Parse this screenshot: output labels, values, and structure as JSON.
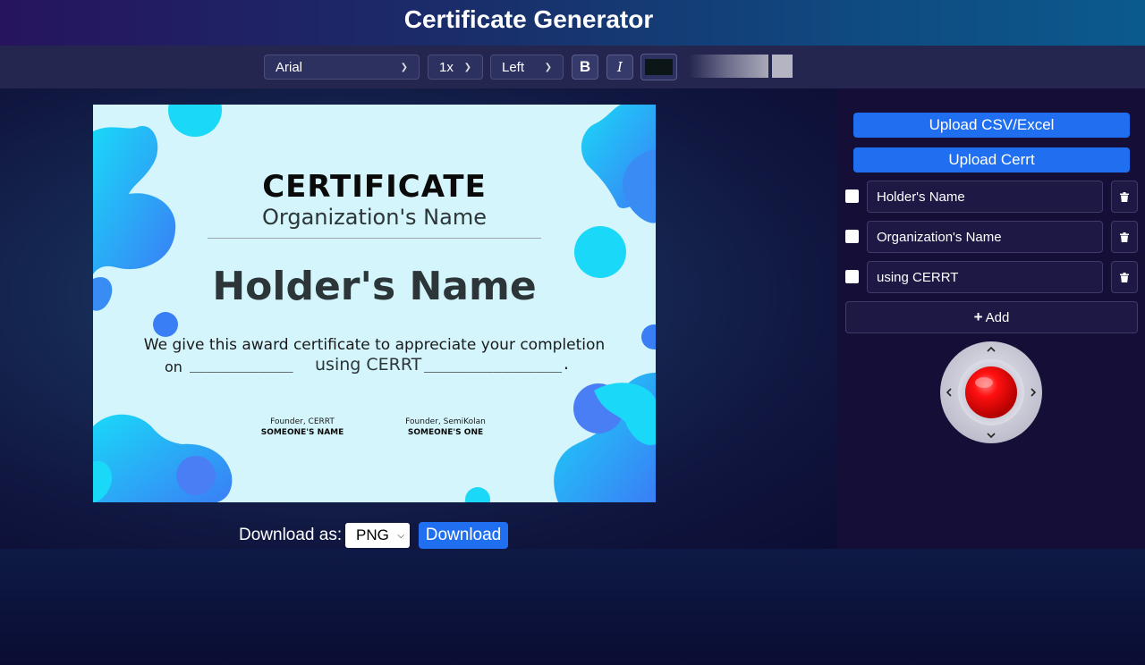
{
  "header": {
    "title": "Certificate Generator"
  },
  "toolbar": {
    "font": "Arial",
    "size": "1x",
    "align": "Left",
    "bold_label": "B",
    "italic_label": "I",
    "text_color": "#0c1617"
  },
  "certificate": {
    "title": "CERTIFICATE",
    "organization": "Organization's Name",
    "holder": "Holder's Name",
    "text_line1": "We give this award certificate to appreciate your completion",
    "text_on": "on",
    "blank_left": "____________",
    "using": "using CERRT",
    "blank_right": "________________.",
    "signatures": [
      {
        "role": "Founder, CERRT",
        "name": "SOMEONE'S NAME"
      },
      {
        "role": "Founder, SemiKolan",
        "name": "SOMEONE'S ONE"
      }
    ],
    "colors": {
      "background": "#d3f5fb",
      "blob_cyan": "#1ad8f8",
      "blob_blue": "#3a8cf5"
    }
  },
  "download": {
    "label": "Download as:",
    "format": "PNG",
    "button": "Download"
  },
  "sidebar": {
    "upload_csv": "Upload CSV/Excel",
    "upload_cert": "Upload Cerrt",
    "fields": [
      {
        "value": "Holder's Name",
        "checked": false
      },
      {
        "value": "Organization's Name",
        "checked": false
      },
      {
        "value": "using CERRT",
        "checked": false
      }
    ],
    "add_label": "Add",
    "accent": "#1f6ff0"
  }
}
